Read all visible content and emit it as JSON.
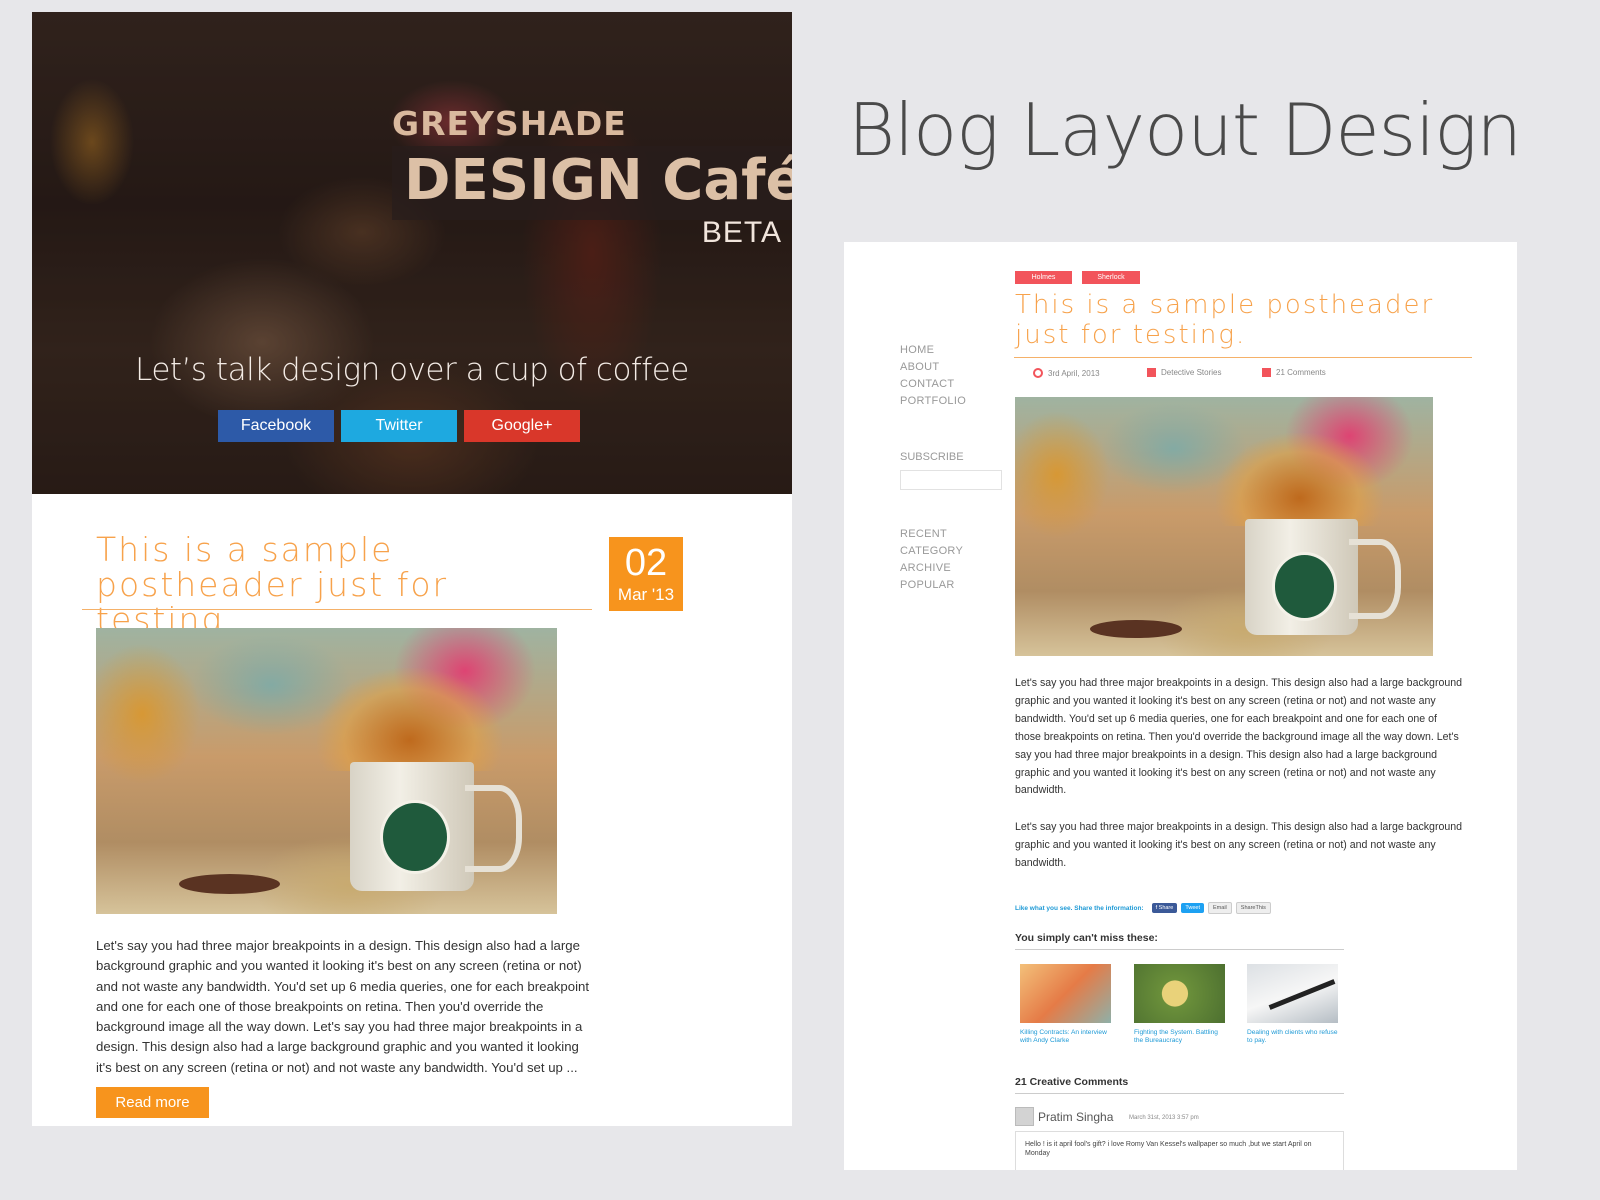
{
  "page_heading": "Blog Layout Design",
  "hero": {
    "pre_title": "GREYSHADE",
    "title": "DESIGN Café",
    "badge": "BETA",
    "tagline": "Let’s talk design over a cup of coffee",
    "social": {
      "facebook": "Facebook",
      "twitter": "Twitter",
      "google": "Google+"
    }
  },
  "colors": {
    "accent": "#f7941d",
    "post_title": "#f7a24b",
    "tag": "#f2545b",
    "facebook": "#2d5aa8",
    "twitter": "#1ea9e0",
    "google": "#d9372a",
    "link": "#1e9ad6"
  },
  "left_post": {
    "title": "This is a sample postheader just for testing.",
    "date_day": "02",
    "date_month": "Mar '13",
    "body": "Let's say you had three major breakpoints in a design. This design also had a large background graphic and you wanted it looking it's best on any screen (retina or not) and not waste any bandwidth. You'd set up 6 media queries, one for each breakpoint and one for each one of those breakpoints on retina. Then you'd override the background image all the way down. Let's say you had three major breakpoints in a design. This design also had a large background graphic and you wanted it looking it's best on any screen (retina or not) and not waste any bandwidth. You'd set up ...",
    "read_more": "Read more"
  },
  "right_post": {
    "tags": [
      "Holmes",
      "Sherlock"
    ],
    "title": "This is a sample postheader just for testing.",
    "meta": {
      "date": "3rd April, 2013",
      "category": "Detective Stories",
      "comments": "21 Comments"
    },
    "paragraph1": "Let's say you had three major breakpoints in a design. This design also had a large background graphic and you wanted it looking it's best on any screen (retina or not) and not waste any bandwidth. You'd set up 6 media queries, one for each breakpoint and one for each one of those breakpoints on retina. Then you'd override the background image all the way down. Let's say you had three major breakpoints in a design. This design also had a large background graphic and you wanted it looking it's best on any screen (retina or not) and not waste any bandwidth.",
    "paragraph2": "Let's say you had three major breakpoints in a design. This design also had a large background graphic and you wanted it looking it's best on any screen (retina or not) and not waste any bandwidth.",
    "share_label": "Like what you see. Share the information:",
    "share_buttons": {
      "facebook": "f Share",
      "twitter": "Tweet",
      "email": "Email",
      "sharethis": "ShareThis"
    },
    "miss_title": "You simply can't miss these:",
    "related": [
      {
        "caption": "Killing Contracts: An interview with Andy Clarke"
      },
      {
        "caption": "Fighting the System. Battling the Bureaucracy"
      },
      {
        "caption": "Dealing with clients who refuse to pay."
      }
    ],
    "comments_title": "21 Creative Comments",
    "comment": {
      "author": "Pratim Singha",
      "date": "March 31st, 2013 3:57 pm",
      "text": "Hello ! is it april fool's gift? i love Romy Van Kessel's wallpaper so much ,but we start April on Monday"
    }
  },
  "sidebar": {
    "nav": [
      "HOME",
      "ABOUT",
      "CONTACT",
      "PORTFOLIO"
    ],
    "subscribe_label": "SUBSCRIBE",
    "subscribe_value": "",
    "links": [
      "RECENT",
      "CATEGORY",
      "ARCHIVE",
      "POPULAR"
    ]
  }
}
